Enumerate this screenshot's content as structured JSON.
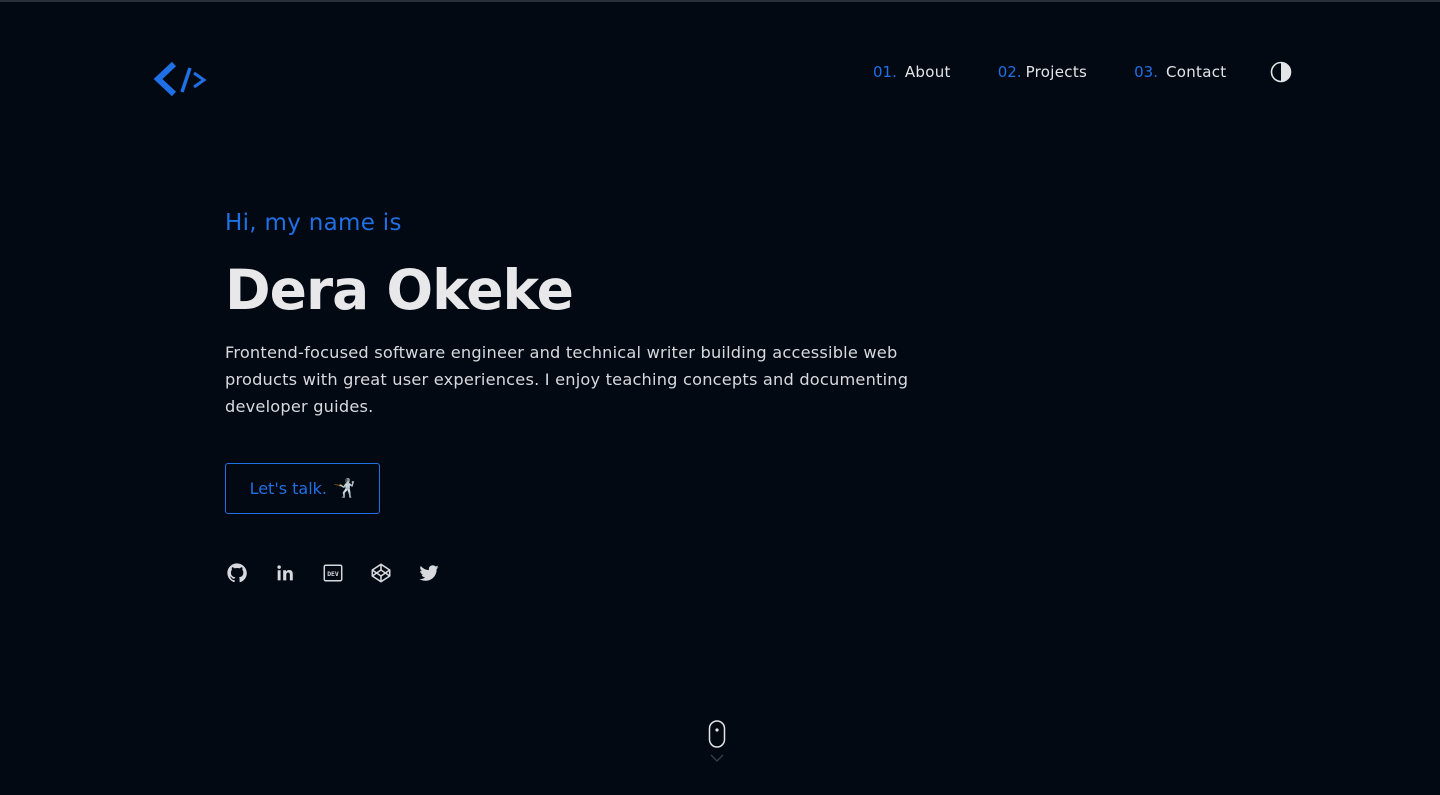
{
  "header": {
    "logo_icon": "code-brackets-icon",
    "nav": [
      {
        "num": "01.",
        "label": "About"
      },
      {
        "num": "02.",
        "label": "Projects"
      },
      {
        "num": "03.",
        "label": "Contact"
      }
    ],
    "theme_toggle_icon": "half-circle-contrast-icon"
  },
  "hero": {
    "greeting": "Hi, my name is",
    "name": "Dera Okeke",
    "bio": "Frontend-focused software engineer and technical writer building accessible web products with great user experiences. I enjoy teaching concepts and documenting developer guides.",
    "cta_label": "Let's talk.",
    "cta_emoji": "🤺"
  },
  "socials": [
    {
      "name": "github-icon"
    },
    {
      "name": "linkedin-icon"
    },
    {
      "name": "dev-to-icon"
    },
    {
      "name": "codepen-icon"
    },
    {
      "name": "twitter-icon"
    }
  ],
  "scroll_indicator": "mouse-scroll-icon",
  "colors": {
    "background": "#030912",
    "accent": "#1f6fe5",
    "text": "#e3e4e8"
  }
}
